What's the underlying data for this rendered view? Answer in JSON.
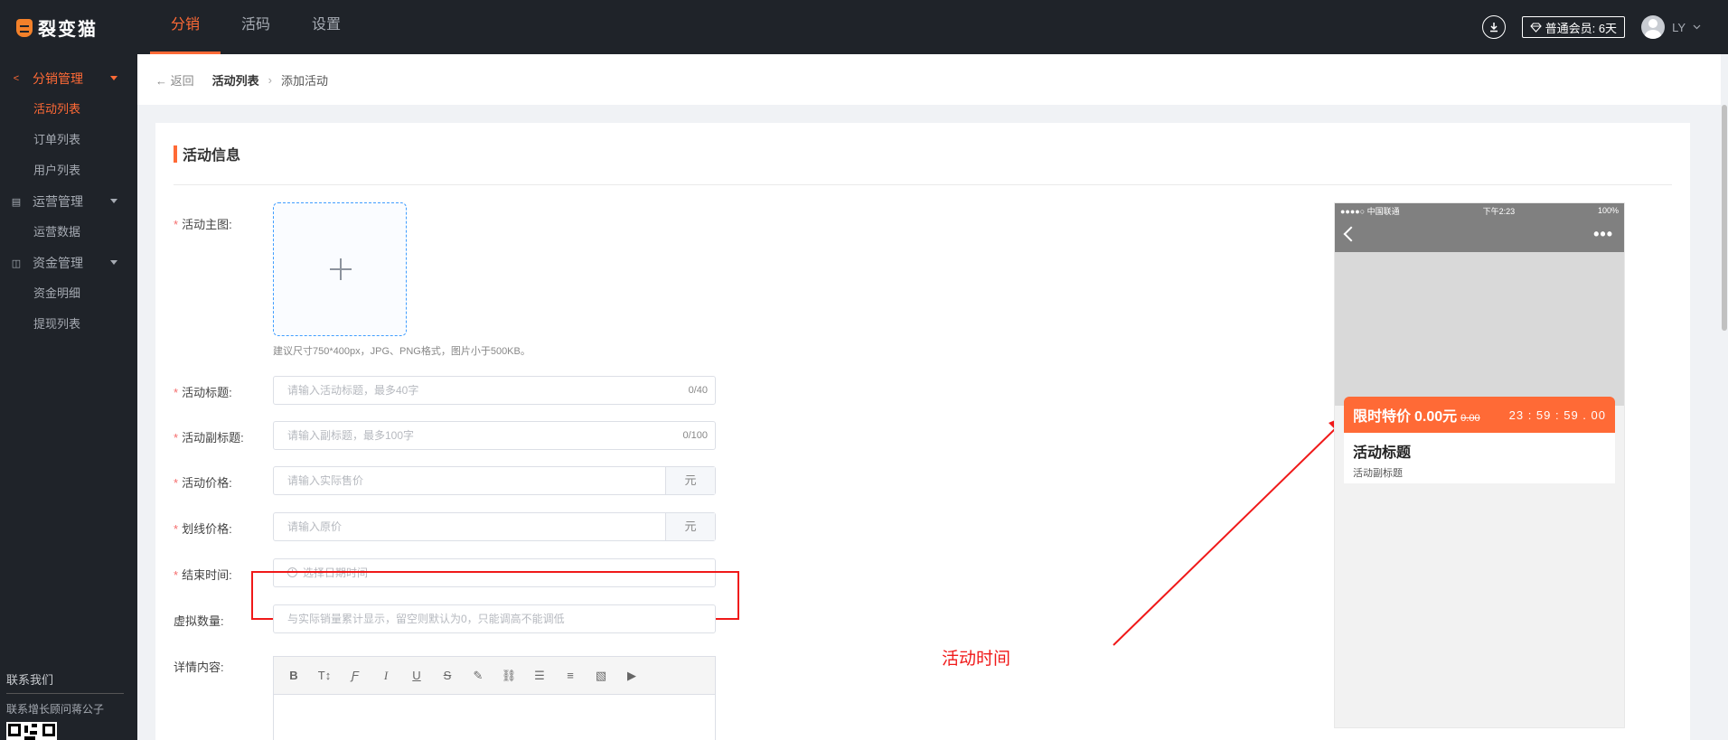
{
  "app": {
    "logo_text": "裂变猫"
  },
  "topnav": {
    "items": [
      {
        "label": "分销"
      },
      {
        "label": "活码"
      },
      {
        "label": "设置"
      }
    ]
  },
  "header": {
    "member_label": "普通会员: 6天",
    "user_name": "LY"
  },
  "sidebar": {
    "groups": [
      {
        "label": "分销管理",
        "items": [
          {
            "label": "活动列表"
          },
          {
            "label": "订单列表"
          },
          {
            "label": "用户列表"
          }
        ]
      },
      {
        "label": "运营管理",
        "items": [
          {
            "label": "运营数据"
          }
        ]
      },
      {
        "label": "资金管理",
        "items": [
          {
            "label": "资金明细"
          },
          {
            "label": "提现列表"
          }
        ]
      }
    ],
    "contact_title": "联系我们",
    "contact_desc": "联系增长顾问蒋公子"
  },
  "breadcrumb": {
    "back": "返回",
    "parent": "活动列表",
    "current": "添加活动"
  },
  "form": {
    "section_title": "活动信息",
    "main_image_label": "活动主图:",
    "main_image_hint": "建议尺寸750*400px，JPG、PNG格式，图片小于500KB。",
    "title_label": "活动标题:",
    "title_placeholder": "请输入活动标题，最多40字",
    "title_count": "0/40",
    "subtitle_label": "活动副标题:",
    "subtitle_placeholder": "请输入副标题，最多100字",
    "subtitle_count": "0/100",
    "price_label": "活动价格:",
    "price_placeholder": "请输入实际售价",
    "price_unit": "元",
    "orig_price_label": "划线价格:",
    "orig_price_placeholder": "请输入原价",
    "orig_price_unit": "元",
    "end_time_label": "结束时间:",
    "end_time_placeholder": "选择日期时间",
    "virtual_label": "虚拟数量:",
    "virtual_placeholder": "与实际销量累计显示，留空则默认为0，只能调高不能调低",
    "detail_label": "详情内容:",
    "toolbar": [
      "B",
      "T↕",
      "Ƒ",
      "I",
      "U",
      "S",
      "✎",
      "⛓",
      "☰",
      "≡",
      "▧",
      "▶"
    ]
  },
  "annotation": {
    "text": "活动时间",
    "color": "#f01919"
  },
  "preview": {
    "carrier": "●●●●○ 中国联通",
    "time": "下午2:23",
    "battery": "100%",
    "more": "•••",
    "price_tag": "限时特价",
    "price": "0.00元",
    "orig_price": "0.00",
    "countdown": "23 : 59 : 59 . 00",
    "title": "活动标题",
    "subtitle": "活动副标题"
  },
  "colors": {
    "accent": "#ff6a36",
    "nav_bg": "#1f2329",
    "annotation": "#f01919"
  }
}
